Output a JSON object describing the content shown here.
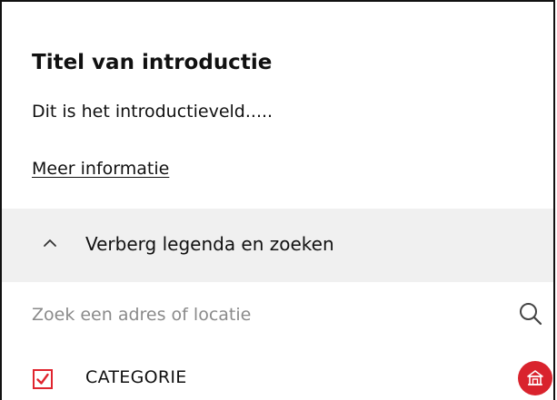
{
  "intro": {
    "title": "Titel van introductie",
    "text": "Dit is het introductieveld.....",
    "link_label": "Meer informatie"
  },
  "legend_toggle": {
    "label": "Verberg legenda en zoeken",
    "icon": "chevron-up-icon"
  },
  "search": {
    "placeholder": "Zoek een adres of locatie",
    "value": "",
    "icon": "search-icon"
  },
  "categories": [
    {
      "label": "CATEGORIE",
      "checked": true,
      "icon": "building-icon",
      "color": "#d9232d"
    }
  ],
  "colors": {
    "accent": "#e0242e",
    "toggle_background": "#f0f0f0",
    "placeholder": "#8a8a8a"
  }
}
